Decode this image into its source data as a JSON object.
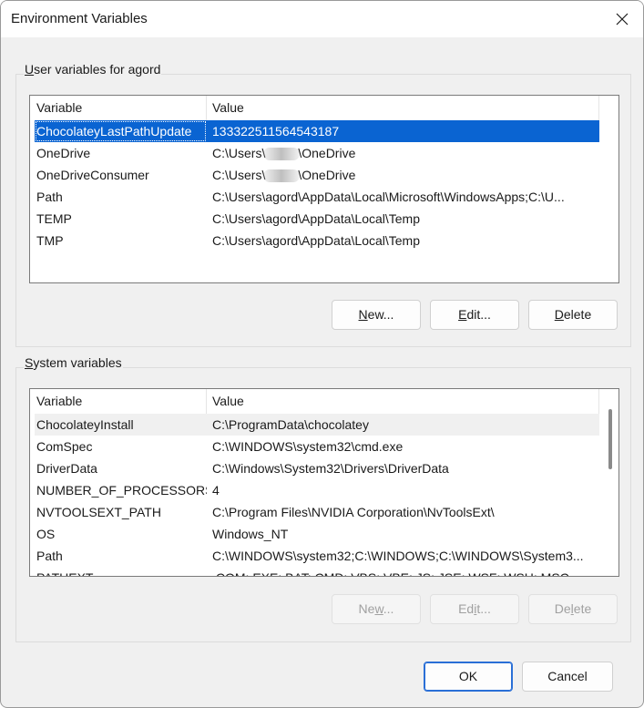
{
  "window": {
    "title": "Environment Variables"
  },
  "user_section": {
    "label_prefix": "U",
    "label_rest": "ser variables for agord",
    "columns": [
      "Variable",
      "Value"
    ],
    "rows": [
      {
        "variable": "ChocolateyLastPathUpdate",
        "value": "133322511564543187"
      },
      {
        "variable": "OneDrive",
        "value_prefix": "C:\\Users\\",
        "value_redacted": "agord",
        "value_suffix": "\\OneDrive"
      },
      {
        "variable": "OneDriveConsumer",
        "value_prefix": "C:\\Users\\",
        "value_redacted": "agord",
        "value_suffix": "\\OneDrive"
      },
      {
        "variable": "Path",
        "value": "C:\\Users\\agord\\AppData\\Local\\Microsoft\\WindowsApps;C:\\U..."
      },
      {
        "variable": "TEMP",
        "value": "C:\\Users\\agord\\AppData\\Local\\Temp"
      },
      {
        "variable": "TMP",
        "value": "C:\\Users\\agord\\AppData\\Local\\Temp"
      }
    ],
    "buttons": {
      "new_ul": "N",
      "new_rest": "ew...",
      "edit_ul": "E",
      "edit_rest": "dit...",
      "delete_ul": "D",
      "delete_rest": "elete"
    }
  },
  "system_section": {
    "label_prefix": "S",
    "label_rest": "ystem variables",
    "columns": [
      "Variable",
      "Value"
    ],
    "rows": [
      {
        "variable": "ChocolateyInstall",
        "value": "C:\\ProgramData\\chocolatey"
      },
      {
        "variable": "ComSpec",
        "value": "C:\\WINDOWS\\system32\\cmd.exe"
      },
      {
        "variable": "DriverData",
        "value": "C:\\Windows\\System32\\Drivers\\DriverData"
      },
      {
        "variable": "NUMBER_OF_PROCESSORS",
        "value": "4"
      },
      {
        "variable": "NVTOOLSEXT_PATH",
        "value": "C:\\Program Files\\NVIDIA Corporation\\NvToolsExt\\"
      },
      {
        "variable": "OS",
        "value": "Windows_NT"
      },
      {
        "variable": "Path",
        "value": "C:\\WINDOWS\\system32;C:\\WINDOWS;C:\\WINDOWS\\System3..."
      },
      {
        "variable": "PATHEXT",
        "value": ".COM;.EXE;.BAT;.CMD;.VBS;.VBE;.JS;.JSE;.WSF;.WSH;.MSC"
      }
    ],
    "buttons": {
      "new_ul": "w",
      "new_pre": "Ne",
      "new_rest": "...",
      "edit_ul": "i",
      "edit_pre": "Ed",
      "edit_rest": "t...",
      "delete_ul": "l",
      "delete_pre": "De",
      "delete_rest": "ete"
    }
  },
  "footer": {
    "ok": "OK",
    "cancel": "Cancel"
  },
  "colors": {
    "selection": "#0a64d2",
    "primary_border": "#2a6fd6"
  }
}
